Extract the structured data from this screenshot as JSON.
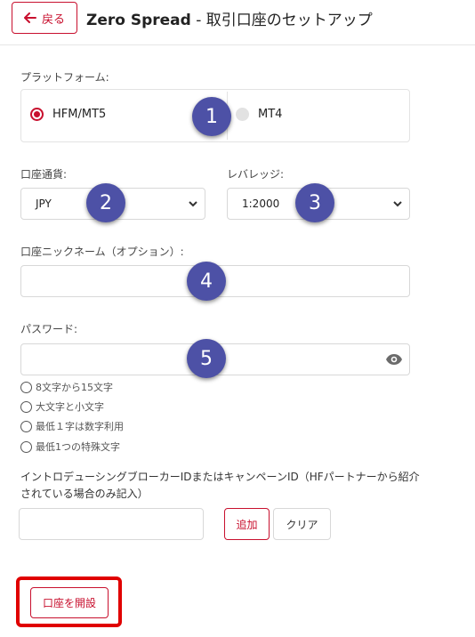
{
  "header": {
    "back_label": "戻る",
    "title_brand": "Zero Spread",
    "title_rest": " - 取引口座のセットアップ"
  },
  "platform": {
    "label": "プラットフォーム:",
    "options": [
      "HFM/MT5",
      "MT4"
    ],
    "selected": "HFM/MT5"
  },
  "currency": {
    "label": "口座通貨:",
    "value": "JPY"
  },
  "leverage": {
    "label": "レバレッジ:",
    "value": "1:2000"
  },
  "nickname": {
    "label": "口座ニックネーム（オプション）:",
    "value": ""
  },
  "password": {
    "label": "パスワード:",
    "value": "",
    "rules": [
      "8文字から15文字",
      "大文字と小文字",
      "最低１字は数字利用",
      "最低1つの特殊文字"
    ]
  },
  "ib": {
    "label": "イントロデューシングブローカーIDまたはキャンペーンID（HFパートナーから紹介されている場合のみ記入）",
    "value": "",
    "add_label": "追加",
    "clear_label": "クリア"
  },
  "submit": {
    "label": "口座を開設"
  },
  "markers": [
    "1",
    "2",
    "3",
    "4",
    "5"
  ],
  "colors": {
    "accent": "#c8102e",
    "marker": "#4d51a6",
    "highlight": "#e00000"
  }
}
